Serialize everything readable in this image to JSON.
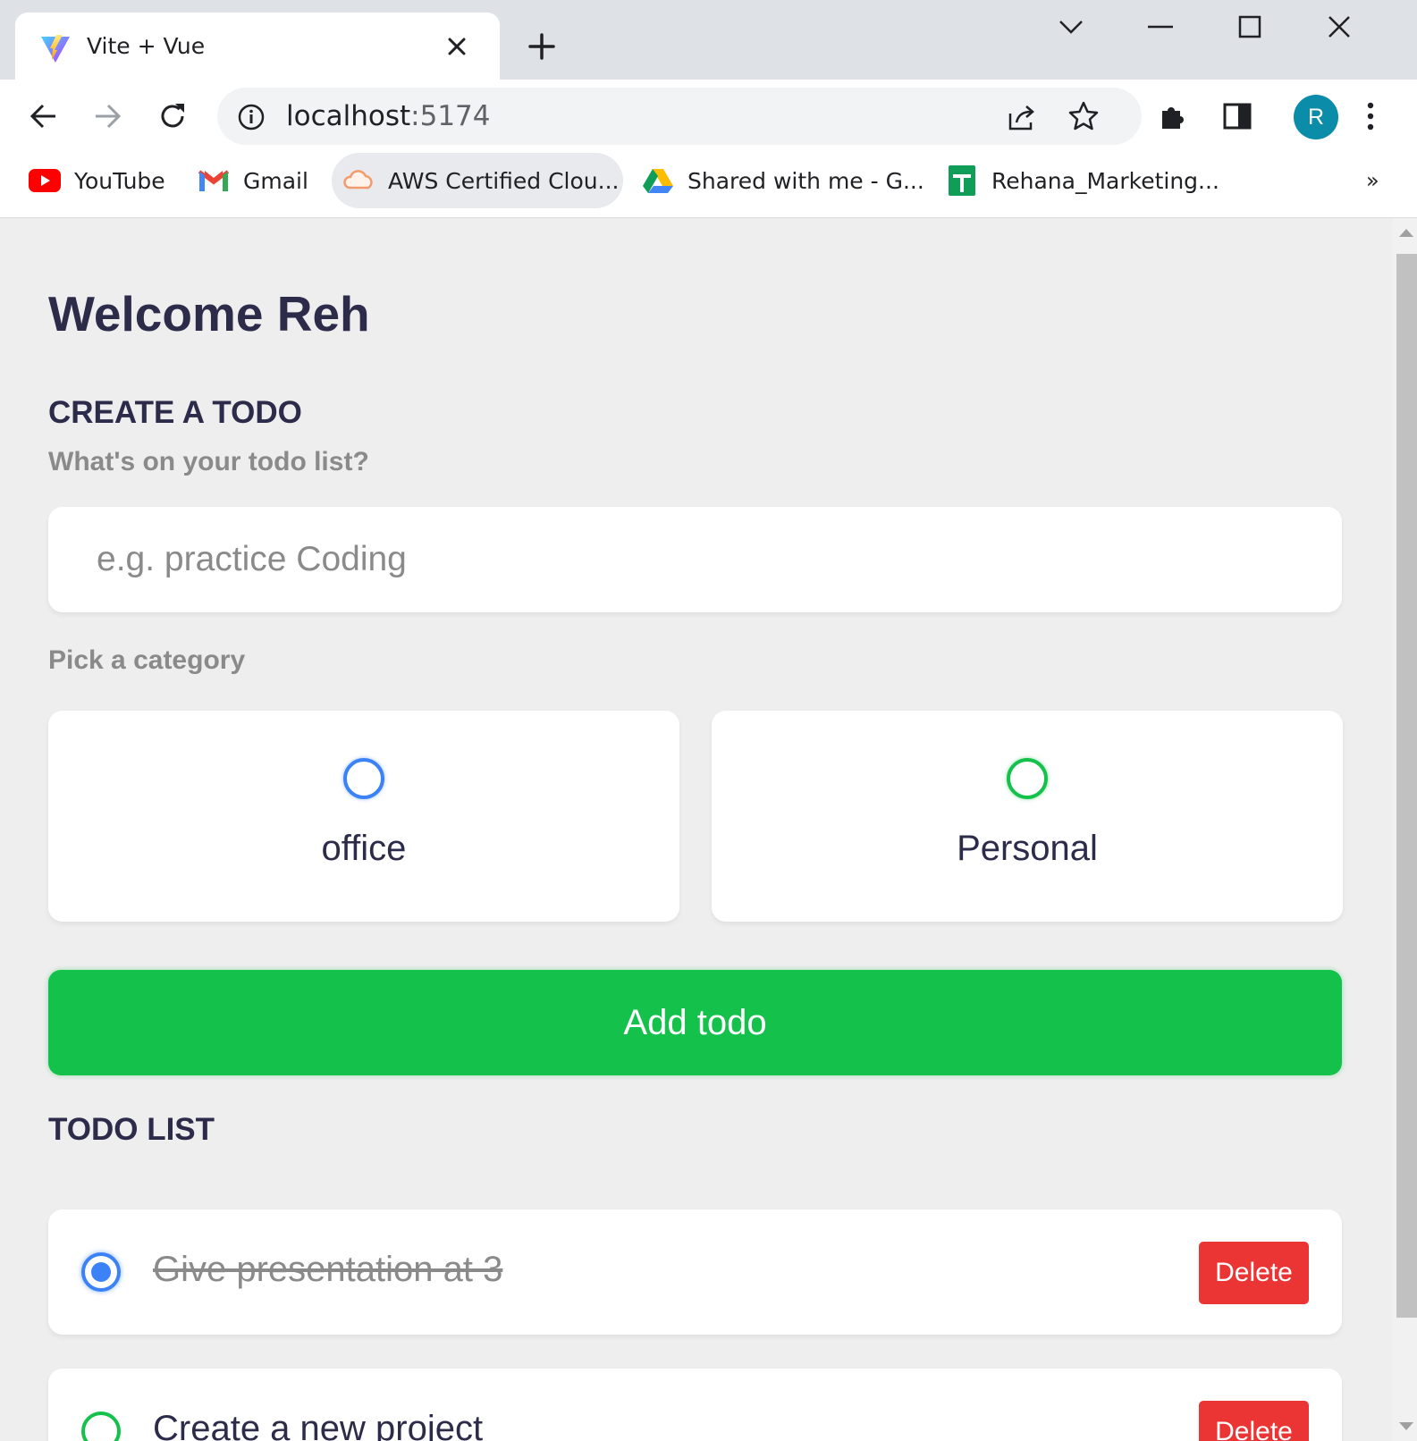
{
  "browser": {
    "tab_title": "Vite + Vue",
    "url_host": "localhost",
    "url_port": ":5174",
    "avatar_letter": "R",
    "bookmarks": [
      {
        "label": "YouTube",
        "icon": "youtube-icon"
      },
      {
        "label": "Gmail",
        "icon": "gmail-icon"
      },
      {
        "label": "AWS Certified Clou...",
        "icon": "cloud-icon"
      },
      {
        "label": "Shared with me - G...",
        "icon": "google-drive-icon"
      },
      {
        "label": "Rehana_Marketing...",
        "icon": "google-sheets-icon"
      }
    ],
    "overflow": "»"
  },
  "page": {
    "greeting": "Welcome Reh",
    "create_heading": "CREATE A TODO",
    "input_label": "What's on your todo list?",
    "input_placeholder": "e.g. practice Coding",
    "input_value": "",
    "category_label": "Pick a category",
    "categories": [
      {
        "label": "office",
        "color": "#3a82f6",
        "selected": false
      },
      {
        "label": "Personal",
        "color": "#14c14b",
        "selected": false
      }
    ],
    "add_button": "Add todo",
    "list_heading": "TODO LIST",
    "todos": [
      {
        "text": "Give presentation at 3",
        "done": true,
        "category_color": "#3a82f6",
        "delete_label": "Delete"
      },
      {
        "text": "Create a new project",
        "done": false,
        "category_color": "#14c14b",
        "delete_label": "Delete"
      }
    ]
  },
  "colors": {
    "accent_green": "#14c14b",
    "accent_blue": "#3a82f6",
    "delete_red": "#eb3434",
    "text_dark": "#2d2b4a"
  }
}
